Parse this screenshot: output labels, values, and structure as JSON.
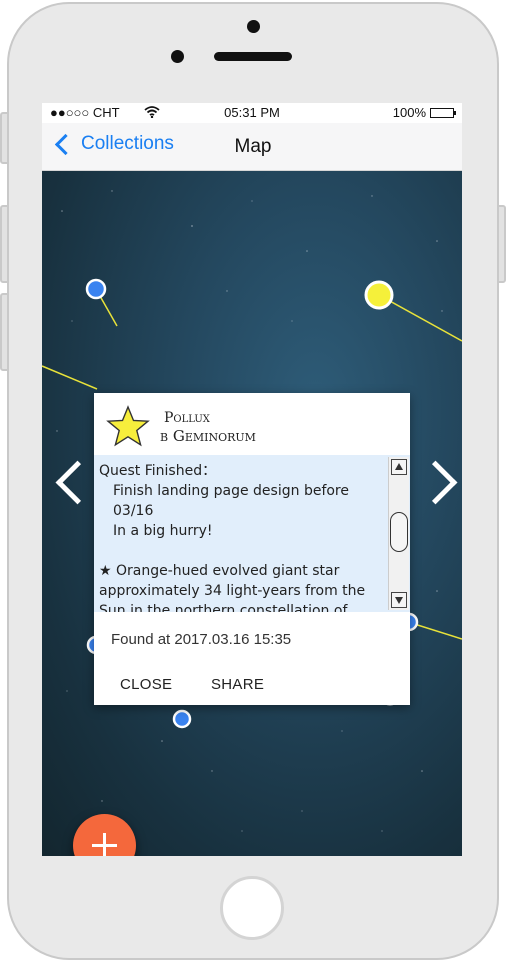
{
  "status_bar": {
    "carrier": "●●○○○ CHT",
    "time": "05:31 PM",
    "battery": "100%"
  },
  "nav": {
    "back_label": "Collections",
    "title": "Map"
  },
  "card": {
    "star_name": "Pollux",
    "star_designation": "β Geminorum",
    "quest_label": "Quest Finished：",
    "quest_lines": [
      "Finish landing page design before 03/16",
      "In a big hurry!"
    ],
    "description": "★  Orange-hued evolved giant star approximately 34 light-years from the Sun in the northern constellation of Gemini. It is the brightest star in the Gemini constellation.",
    "found_at": "Found at 2017.03.16 15:35",
    "close_label": "CLOSE",
    "share_label": "SHARE"
  },
  "colors": {
    "accent": "#1a7ff2",
    "fab": "#f4683c",
    "star_blue": "#3a83f0",
    "star_yellow": "#f5f03a",
    "line": "#e8e23a",
    "card_body": "#e1eefb"
  },
  "icons": [
    "chevron-left-icon",
    "wifi-icon",
    "battery-icon",
    "star-icon",
    "arrow-left-icon",
    "arrow-right-icon",
    "plus-icon"
  ]
}
